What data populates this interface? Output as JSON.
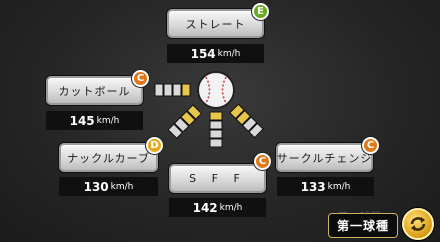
{
  "pitches": [
    {
      "id": "straight",
      "name": "ストレート",
      "speed": "154",
      "unit": "km/h",
      "grade": "E"
    },
    {
      "id": "cut",
      "name": "カットボール",
      "speed": "145",
      "unit": "km/h",
      "grade": "C"
    },
    {
      "id": "knuckle",
      "name": "ナックルカーブ",
      "speed": "130",
      "unit": "km/h",
      "grade": "D"
    },
    {
      "id": "sff",
      "name": "S F F",
      "speed": "142",
      "unit": "km/h",
      "grade": "C"
    },
    {
      "id": "circle",
      "name": "サークルチェンジ",
      "speed": "133",
      "unit": "km/h",
      "grade": "C"
    }
  ],
  "bottom": {
    "label": "第一球種",
    "ghost": "第一球種"
  },
  "colors": {
    "grade_c": "#e2771a",
    "grade_d": "#e6a81a",
    "grade_e": "#6aaa1e",
    "arrow_yellow": "#e8c64a"
  },
  "icons": {
    "ball": "baseball-icon",
    "cycle": "switch-cycle-icon"
  }
}
